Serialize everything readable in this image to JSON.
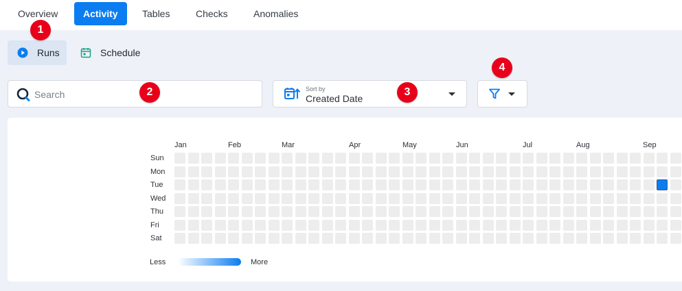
{
  "tabs": [
    {
      "label": "Overview",
      "active": false
    },
    {
      "label": "Activity",
      "active": true
    },
    {
      "label": "Tables",
      "active": false
    },
    {
      "label": "Checks",
      "active": false
    },
    {
      "label": "Anomalies",
      "active": false
    }
  ],
  "subtabs": [
    {
      "label": "Runs",
      "icon": "play-circle-icon",
      "active": true
    },
    {
      "label": "Schedule",
      "icon": "calendar-icon",
      "active": false
    }
  ],
  "search": {
    "placeholder": "Search",
    "value": ""
  },
  "sort": {
    "caption": "Sort by",
    "value": "Created Date"
  },
  "markers": [
    "1",
    "2",
    "3",
    "4"
  ],
  "heatmap": {
    "months": [
      "Jan",
      "Feb",
      "Mar",
      "Apr",
      "May",
      "Jun",
      "Jul",
      "Aug",
      "Sep"
    ],
    "days": [
      "Sun",
      "Mon",
      "Tue",
      "Wed",
      "Thu",
      "Fri",
      "Sat"
    ],
    "weeks_visible": 38,
    "active_cells": [
      {
        "week": 36,
        "day": "Tue",
        "level": "high"
      }
    ],
    "legend_less": "Less",
    "legend_more": "More"
  },
  "colors": {
    "accent": "#0b7df0",
    "marker": "#e8001a",
    "empty_cell": "#ededed",
    "page_bg": "#eef2f8"
  }
}
